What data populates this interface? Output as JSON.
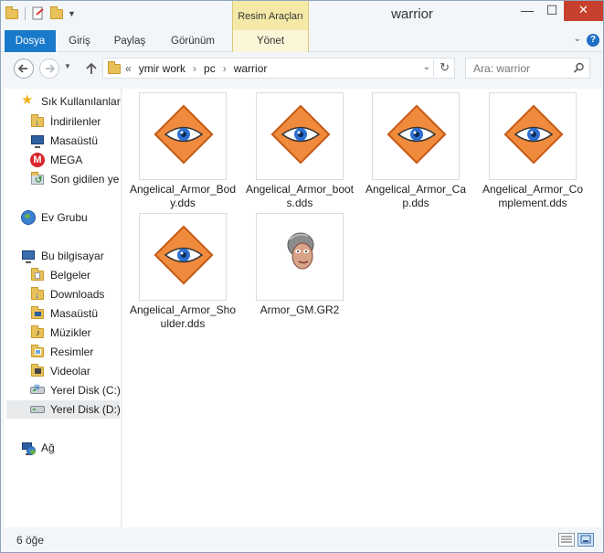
{
  "window": {
    "title": "warrior"
  },
  "contextual_tab": {
    "group_label": "Resim Araçları"
  },
  "ribbon": {
    "tabs": [
      {
        "label": "Dosya"
      },
      {
        "label": "Giriş"
      },
      {
        "label": "Paylaş"
      },
      {
        "label": "Görünüm"
      },
      {
        "label": "Yönet"
      }
    ]
  },
  "address": {
    "overflow": "«",
    "crumbs": [
      "ymir work",
      "pc",
      "warrior"
    ]
  },
  "search": {
    "placeholder": "Ara: warrior"
  },
  "nav": {
    "items": [
      {
        "label": "Sık Kullanılanlar",
        "icon": "star-icon"
      },
      {
        "label": "İndirilenler",
        "icon": "downloads-folder-icon"
      },
      {
        "label": "Masaüstü",
        "icon": "desktop-icon"
      },
      {
        "label": "MEGA",
        "icon": "mega-icon"
      },
      {
        "label": "Son gidilen ye",
        "icon": "recent-places-icon"
      },
      {
        "label": "Ev Grubu",
        "icon": "homegroup-icon"
      },
      {
        "label": "Bu bilgisayar",
        "icon": "computer-icon"
      },
      {
        "label": "Belgeler",
        "icon": "documents-folder-icon"
      },
      {
        "label": "Downloads",
        "icon": "downloads-folder-icon"
      },
      {
        "label": "Masaüstü",
        "icon": "desktop-folder-icon"
      },
      {
        "label": "Müzikler",
        "icon": "music-folder-icon"
      },
      {
        "label": "Resimler",
        "icon": "pictures-folder-icon"
      },
      {
        "label": "Videolar",
        "icon": "videos-folder-icon"
      },
      {
        "label": "Yerel Disk (C:)",
        "icon": "system-drive-icon"
      },
      {
        "label": "Yerel Disk (D:)",
        "icon": "drive-icon",
        "selected": true
      },
      {
        "label": "Ağ",
        "icon": "network-icon"
      }
    ]
  },
  "files": [
    {
      "name": "Angelical_Armor_Body.dds",
      "icon": "dds-eye-icon"
    },
    {
      "name": "Angelical_Armor_boots.dds",
      "icon": "dds-eye-icon"
    },
    {
      "name": "Angelical_Armor_Cap.dds",
      "icon": "dds-eye-icon"
    },
    {
      "name": "Angelical_Armor_Complement.dds",
      "icon": "dds-eye-icon"
    },
    {
      "name": "Angelical_Armor_Shoulder.dds",
      "icon": "dds-eye-icon"
    },
    {
      "name": "Armor_GM.GR2",
      "icon": "gr2-granny-icon"
    }
  ],
  "status": {
    "item_count": "6 öğe"
  }
}
